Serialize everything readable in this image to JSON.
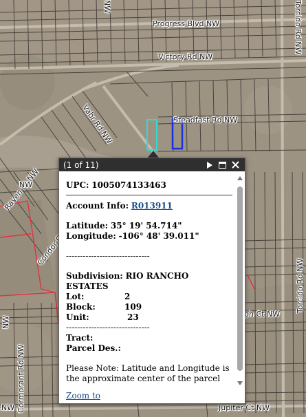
{
  "map": {
    "roads": [
      {
        "key": "progress",
        "label": "Progress Blvd NW"
      },
      {
        "key": "victory",
        "label": "Victory Rd NW"
      },
      {
        "key": "vabr",
        "label": "Vabr Rd NW"
      },
      {
        "key": "steadfast",
        "label": "Steadfast Rd NW"
      },
      {
        "key": "torcido_top",
        "label": "Torcido Rd NW"
      },
      {
        "key": "torcido_bottom",
        "label": "Torcido Rd NW"
      },
      {
        "key": "nw_top",
        "label": "NW"
      },
      {
        "key": "raven",
        "label": "Raven Ct NW"
      },
      {
        "key": "condor",
        "label": "Condor Ct NW"
      },
      {
        "key": "cormorant",
        "label": "Cormorant Rd NW"
      },
      {
        "key": "ph_ct",
        "label": "ph Ct NW"
      },
      {
        "key": "jupiter",
        "label": "Jupiter Ct NW"
      },
      {
        "key": "nw_left1",
        "label": "NW"
      },
      {
        "key": "nw_left2",
        "label": "NW"
      },
      {
        "key": "nw_bottom",
        "label": "NW"
      }
    ],
    "colors": {
      "aerial": "#9c9181",
      "parcel_line": "#3a3530",
      "boundary": "#e0333f",
      "highlight_cyan": "#33d8d0",
      "highlight_blue": "#1a2fe0"
    }
  },
  "popup": {
    "counter": "(1 of 11)",
    "upc_label": "UPC:",
    "upc_value": "1005074133463",
    "account_label": "Account Info:",
    "account_link": "R013911",
    "latitude_label": "Latitude:",
    "latitude_value": "35° 19' 54.714\"",
    "longitude_label": "Longitude:",
    "longitude_value": "-106° 48' 39.011\"",
    "dashes1": "------------------------------",
    "subdivision_label": "Subdivision:",
    "subdivision_value": "RIO RANCHO ESTATES",
    "lot_label": "Lot:",
    "lot_value": "2",
    "block_label": "Block:",
    "block_value": "109",
    "unit_label": "Unit:",
    "unit_value": "23",
    "dashes2": "------------------------------",
    "tract_label": "Tract:",
    "parcel_des_label": "Parcel Des.:",
    "note": "Please Note: Latitude and Longitude is the approximate center of the parcel shown.",
    "zoom_link": "Zoom to",
    "icons": [
      "next-arrow-icon",
      "maximize-icon",
      "close-icon"
    ]
  }
}
